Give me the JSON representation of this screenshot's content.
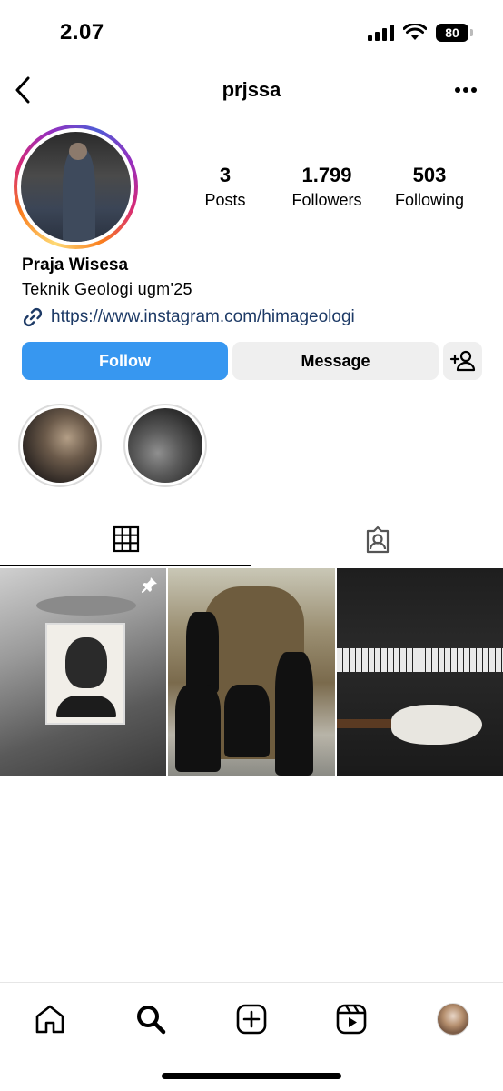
{
  "status_bar": {
    "time": "2.07",
    "battery": "80"
  },
  "header": {
    "username": "prjssa"
  },
  "profile": {
    "stats": {
      "posts_count": "3",
      "posts_label": "Posts",
      "followers_count": "1.799",
      "followers_label": "Followers",
      "following_count": "503",
      "following_label": "Following"
    },
    "full_name": "Praja Wisesa",
    "bio": "Teknik Geologi ugm'25",
    "link": "https://www.instagram.com/himageologi"
  },
  "actions": {
    "follow_label": "Follow",
    "message_label": "Message"
  },
  "colors": {
    "follow_blue": "#3797f0",
    "link_text": "#1d3a66",
    "secondary_button": "#efefef"
  },
  "icons": {
    "back": "chevron-left-icon",
    "more": "more-horizontal-icon",
    "link": "link-icon",
    "add_user": "add-user-icon",
    "grid": "grid-icon",
    "tagged": "tagged-icon",
    "pin": "pin-icon",
    "home": "home-icon",
    "search": "search-icon",
    "create": "create-icon",
    "reels": "reels-icon"
  }
}
